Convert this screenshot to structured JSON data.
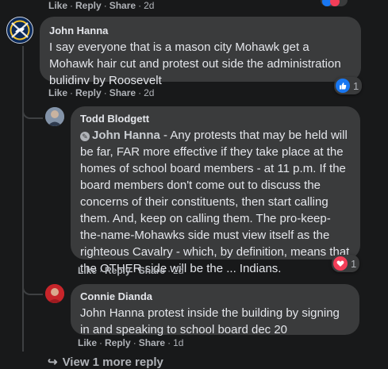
{
  "top_actions": {
    "like": "Like",
    "reply": "Reply",
    "share": "Share",
    "time": "2d"
  },
  "comment1": {
    "author": "John Hanna",
    "text": "I say everyone that is a mason city Mohawk get a Mohawk hair cut and protest out side the administration bulidinv by Roosevelt",
    "reaction_count": "1",
    "actions": {
      "like": "Like",
      "reply": "Reply",
      "share": "Share",
      "time": "2d"
    }
  },
  "reply1": {
    "author": "Todd Blodgett",
    "mention": "John Hanna",
    "text": " - Any protests that may be held will be far, FAR more effective if they take place at the homes of school board members - at 11 p.m. If the board members don't come out to discuss the concerns of their constituents, then start calling them. And, keep on calling them. The pro-keep-the-name-Mohawks side must view itself as the righteous Cavalry - which, by definition, means that the OTHER side will be the ... Indians.",
    "reaction_count": "1",
    "actions": {
      "like": "Like",
      "reply": "Reply",
      "share": "Share",
      "time": "2d"
    }
  },
  "reply2": {
    "author": "Connie Dianda",
    "text": "John Hanna protest inside the building by signing in and speaking to school board dec 20",
    "actions": {
      "like": "Like",
      "reply": "Reply",
      "share": "Share",
      "time": "1d"
    }
  },
  "view_more": "View 1 more reply",
  "colors": {
    "like_blue": "#1877f2",
    "love_red": "#f33e58",
    "bg": "#18191a",
    "bubble": "#3a3b3c"
  }
}
